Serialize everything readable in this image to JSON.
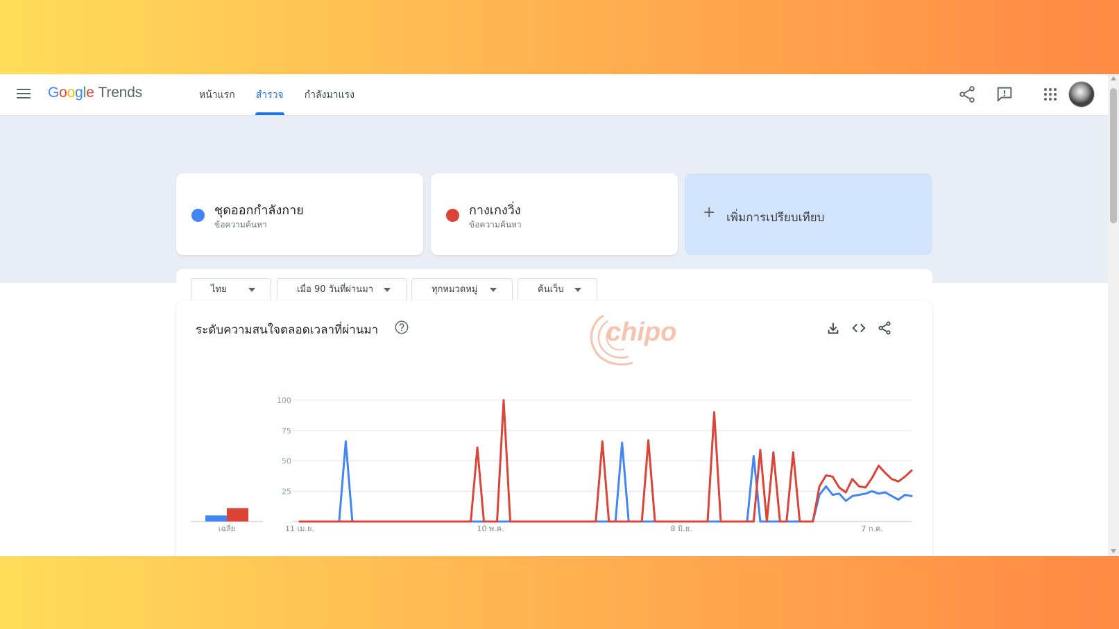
{
  "app": {
    "logo_google": "Google",
    "logo_trends": "Trends",
    "nav_tabs": [
      {
        "label": "หน้าแรก",
        "active": false
      },
      {
        "label": "สำรวจ",
        "active": true
      },
      {
        "label": "กำลังมาแรง",
        "active": false
      }
    ],
    "header_icons": [
      "menu-icon",
      "share-icon",
      "feedback-icon",
      "apps-grid-icon",
      "avatar"
    ]
  },
  "compare": {
    "terms": [
      {
        "name": "ชุดออกกำลังกาย",
        "subtitle": "ข้อความค้นหา",
        "color": "#4285f4"
      },
      {
        "name": "กางเกงวิ่ง",
        "subtitle": "ข้อความค้นหา",
        "color": "#db4437"
      }
    ],
    "add_label": "เพิ่มการเปรียบเทียบ"
  },
  "filters": {
    "region": "ไทย",
    "time_range": "เมื่อ 90 วันที่ผ่านมา",
    "category": "ทุกหมวดหมู่",
    "search_type": "ค้นเว็บ"
  },
  "chart_card": {
    "title": "ระดับความสนใจตลอดเวลาที่ผ่านมา",
    "actions": [
      "download-icon",
      "embed-code-icon",
      "share-icon"
    ],
    "watermark": "chipo"
  },
  "chart_data": {
    "type": "line",
    "ylim": [
      0,
      100
    ],
    "yticks": [
      "25",
      "50",
      "75",
      "100"
    ],
    "x_tick_labels": [
      "11 เม.ย.",
      "10 พ.ค.",
      "8 มิ.ย.",
      "7 ก.ค."
    ],
    "average_label": "เฉลี่ย",
    "average": [
      {
        "series": "ชุดออกกำลังกาย",
        "value": 5
      },
      {
        "series": "กางเกงวิ่ง",
        "value": 11
      }
    ],
    "series": [
      {
        "name": "ชุดออกกำลังกาย",
        "color": "#4285f4",
        "values": [
          0,
          0,
          0,
          0,
          0,
          0,
          0,
          66,
          0,
          0,
          0,
          0,
          0,
          0,
          0,
          0,
          0,
          0,
          0,
          0,
          0,
          0,
          0,
          0,
          0,
          0,
          0,
          0,
          0,
          0,
          0,
          0,
          0,
          0,
          0,
          0,
          0,
          0,
          0,
          0,
          0,
          0,
          0,
          0,
          0,
          0,
          0,
          0,
          0,
          65,
          0,
          0,
          0,
          0,
          0,
          0,
          0,
          0,
          0,
          0,
          0,
          0,
          0,
          0,
          0,
          0,
          0,
          0,
          0,
          54,
          0,
          0,
          0,
          0,
          0,
          0,
          0,
          0,
          0,
          22,
          29,
          22,
          23,
          17,
          21,
          22,
          23,
          25,
          23,
          24,
          21,
          18,
          22,
          21
        ]
      },
      {
        "name": "กางเกงวิ่ง",
        "color": "#db4437",
        "values": [
          0,
          0,
          0,
          0,
          0,
          0,
          0,
          0,
          0,
          0,
          0,
          0,
          0,
          0,
          0,
          0,
          0,
          0,
          0,
          0,
          0,
          0,
          0,
          0,
          0,
          0,
          0,
          61,
          0,
          0,
          0,
          100,
          0,
          0,
          0,
          0,
          0,
          0,
          0,
          0,
          0,
          0,
          0,
          0,
          0,
          0,
          66,
          0,
          0,
          0,
          0,
          0,
          0,
          67,
          0,
          0,
          0,
          0,
          0,
          0,
          0,
          0,
          0,
          90,
          0,
          0,
          0,
          0,
          0,
          0,
          59,
          0,
          57,
          0,
          0,
          57,
          0,
          0,
          0,
          29,
          38,
          37,
          28,
          24,
          35,
          29,
          28,
          36,
          46,
          40,
          35,
          33,
          37,
          42
        ]
      }
    ]
  }
}
